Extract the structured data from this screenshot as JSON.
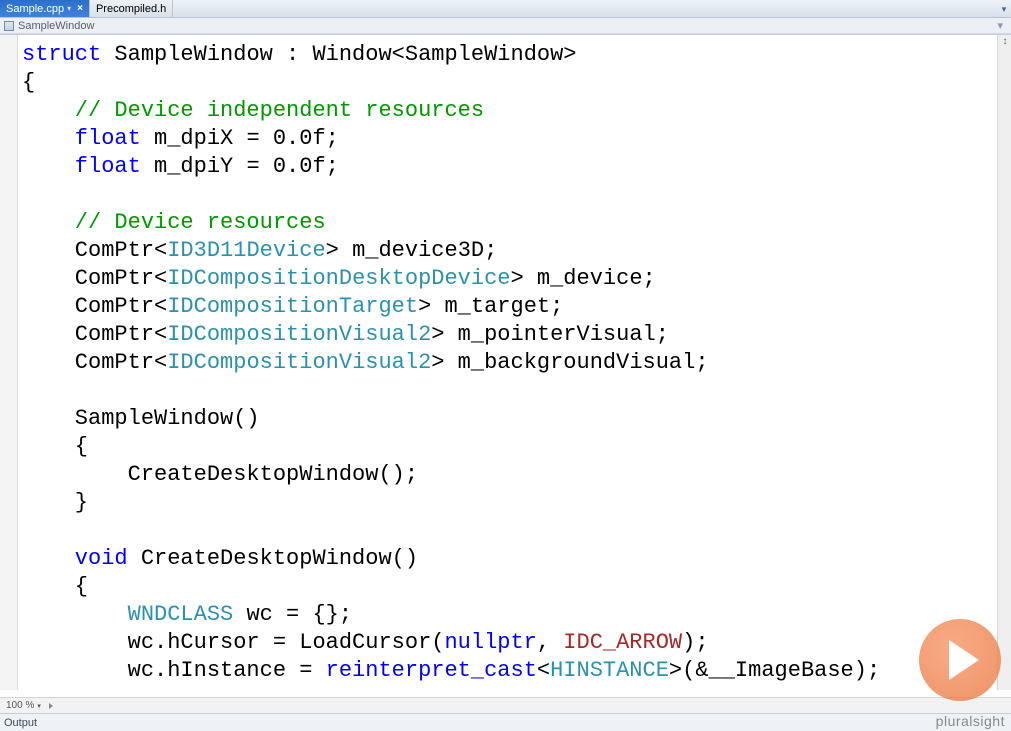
{
  "tabs": [
    {
      "label": "Sample.cpp",
      "active": true,
      "closable": true,
      "dropdown": true
    },
    {
      "label": "Precompiled.h",
      "active": false,
      "closable": false,
      "dropdown": false
    }
  ],
  "breadcrumb": {
    "icon": "struct-icon",
    "item": "SampleWindow"
  },
  "code": {
    "line1_kw": "struct",
    "line1_rest": " SampleWindow : Window<SampleWindow>",
    "openBrace": "{",
    "comment1": "    // Device independent resources",
    "line_float1_kw": "    float",
    "line_float1_rest": " m_dpiX = 0.0f;",
    "line_float2_kw": "    float",
    "line_float2_rest": " m_dpiY = 0.0f;",
    "comment2": "    // Device resources",
    "cptr1_a": "    ComPtr<",
    "cptr1_t": "ID3D11Device",
    "cptr1_b": "> m_device3D;",
    "cptr2_a": "    ComPtr<",
    "cptr2_t": "IDCompositionDesktopDevice",
    "cptr2_b": "> m_device;",
    "cptr3_a": "    ComPtr<",
    "cptr3_t": "IDCompositionTarget",
    "cptr3_b": "> m_target;",
    "cptr4_a": "    ComPtr<",
    "cptr4_t": "IDCompositionVisual2",
    "cptr4_b": "> m_pointerVisual;",
    "cptr5_a": "    ComPtr<",
    "cptr5_t": "IDCompositionVisual2",
    "cptr5_b": "> m_backgroundVisual;",
    "ctor_sig": "    SampleWindow()",
    "ctor_open": "    {",
    "ctor_body": "        CreateDesktopWindow();",
    "ctor_close": "    }",
    "fn_kw": "    void",
    "fn_rest": " CreateDesktopWindow()",
    "fn_open": "    {",
    "wc_decl_a": "        ",
    "wc_decl_t": "WNDCLASS",
    "wc_decl_b": " wc = {};",
    "wc_cur_a": "        wc.hCursor = LoadCursor(",
    "wc_cur_kw": "nullptr",
    "wc_cur_b": ", ",
    "wc_cur_m": "IDC_ARROW",
    "wc_cur_c": ");",
    "wc_hi_a": "        wc.hInstance = ",
    "wc_hi_kw": "reinterpret_cast",
    "wc_hi_b": "<",
    "wc_hi_t": "HINSTANCE",
    "wc_hi_c": ">(&__ImageBase);"
  },
  "zoom": {
    "label": "100 %"
  },
  "output": {
    "label": "Output"
  },
  "brand": "pluralsight"
}
